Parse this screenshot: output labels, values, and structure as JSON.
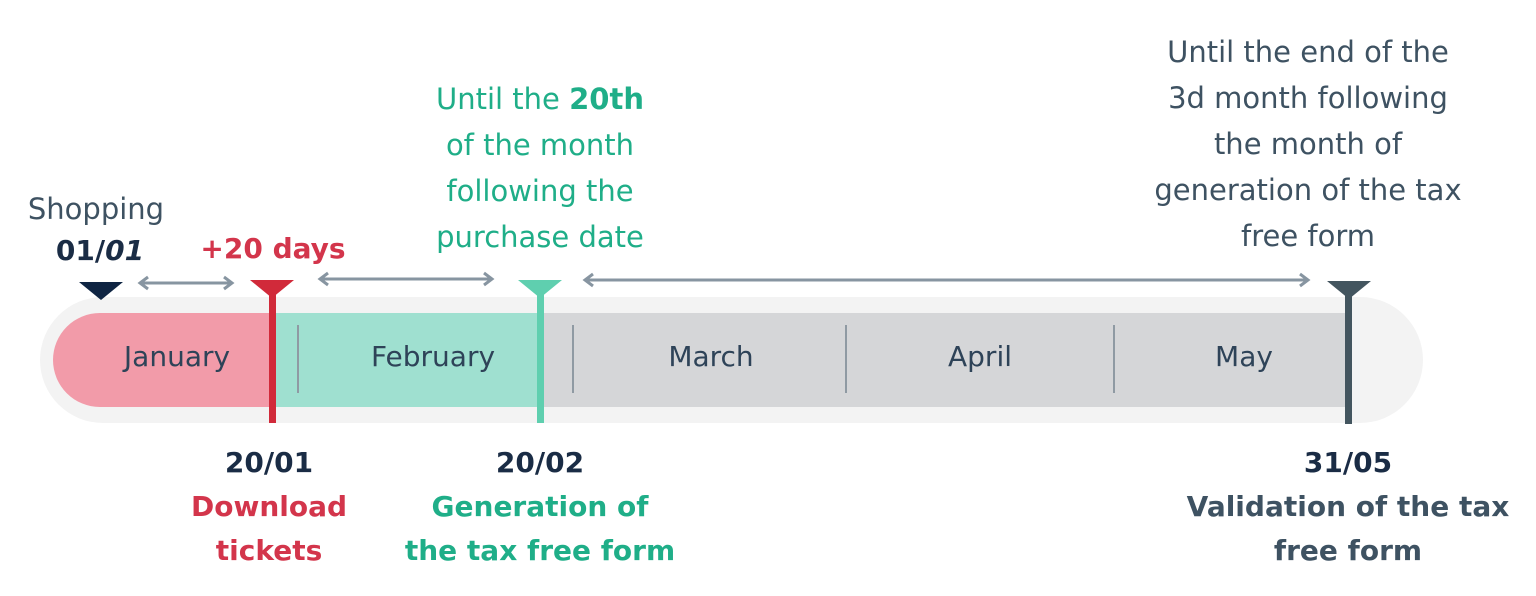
{
  "colors": {
    "navy": "#0f2543",
    "red": "#d12a3a",
    "pink": "#f29ba9",
    "teal": "#5fcfaf",
    "teal_fill": "#9fe0d0",
    "gray": "#d5d6d8",
    "slate": "#43555f"
  },
  "top_notes": {
    "shopping": "Shopping",
    "shopping_date_a": "01/",
    "shopping_date_b": "01",
    "plus_days": "+20 days",
    "teal_note": {
      "l1a": "Until the ",
      "l1b": "20th",
      "l2": "of the month",
      "l3": "following the",
      "l4": "purchase date"
    },
    "end_note": [
      "Until the end of the",
      "3d month following",
      "the month of",
      "generation of the tax",
      "free form"
    ]
  },
  "months": [
    "January",
    "February",
    "March",
    "April",
    "May"
  ],
  "bottom": {
    "red": {
      "date": "20/01",
      "l1": "Download",
      "l2": "tickets"
    },
    "green": {
      "date": "20/02",
      "l1": "Generation of",
      "l2": "the tax free form"
    },
    "slate": {
      "date": "31/05",
      "l1": "Validation of the tax",
      "l2": "free form"
    }
  }
}
